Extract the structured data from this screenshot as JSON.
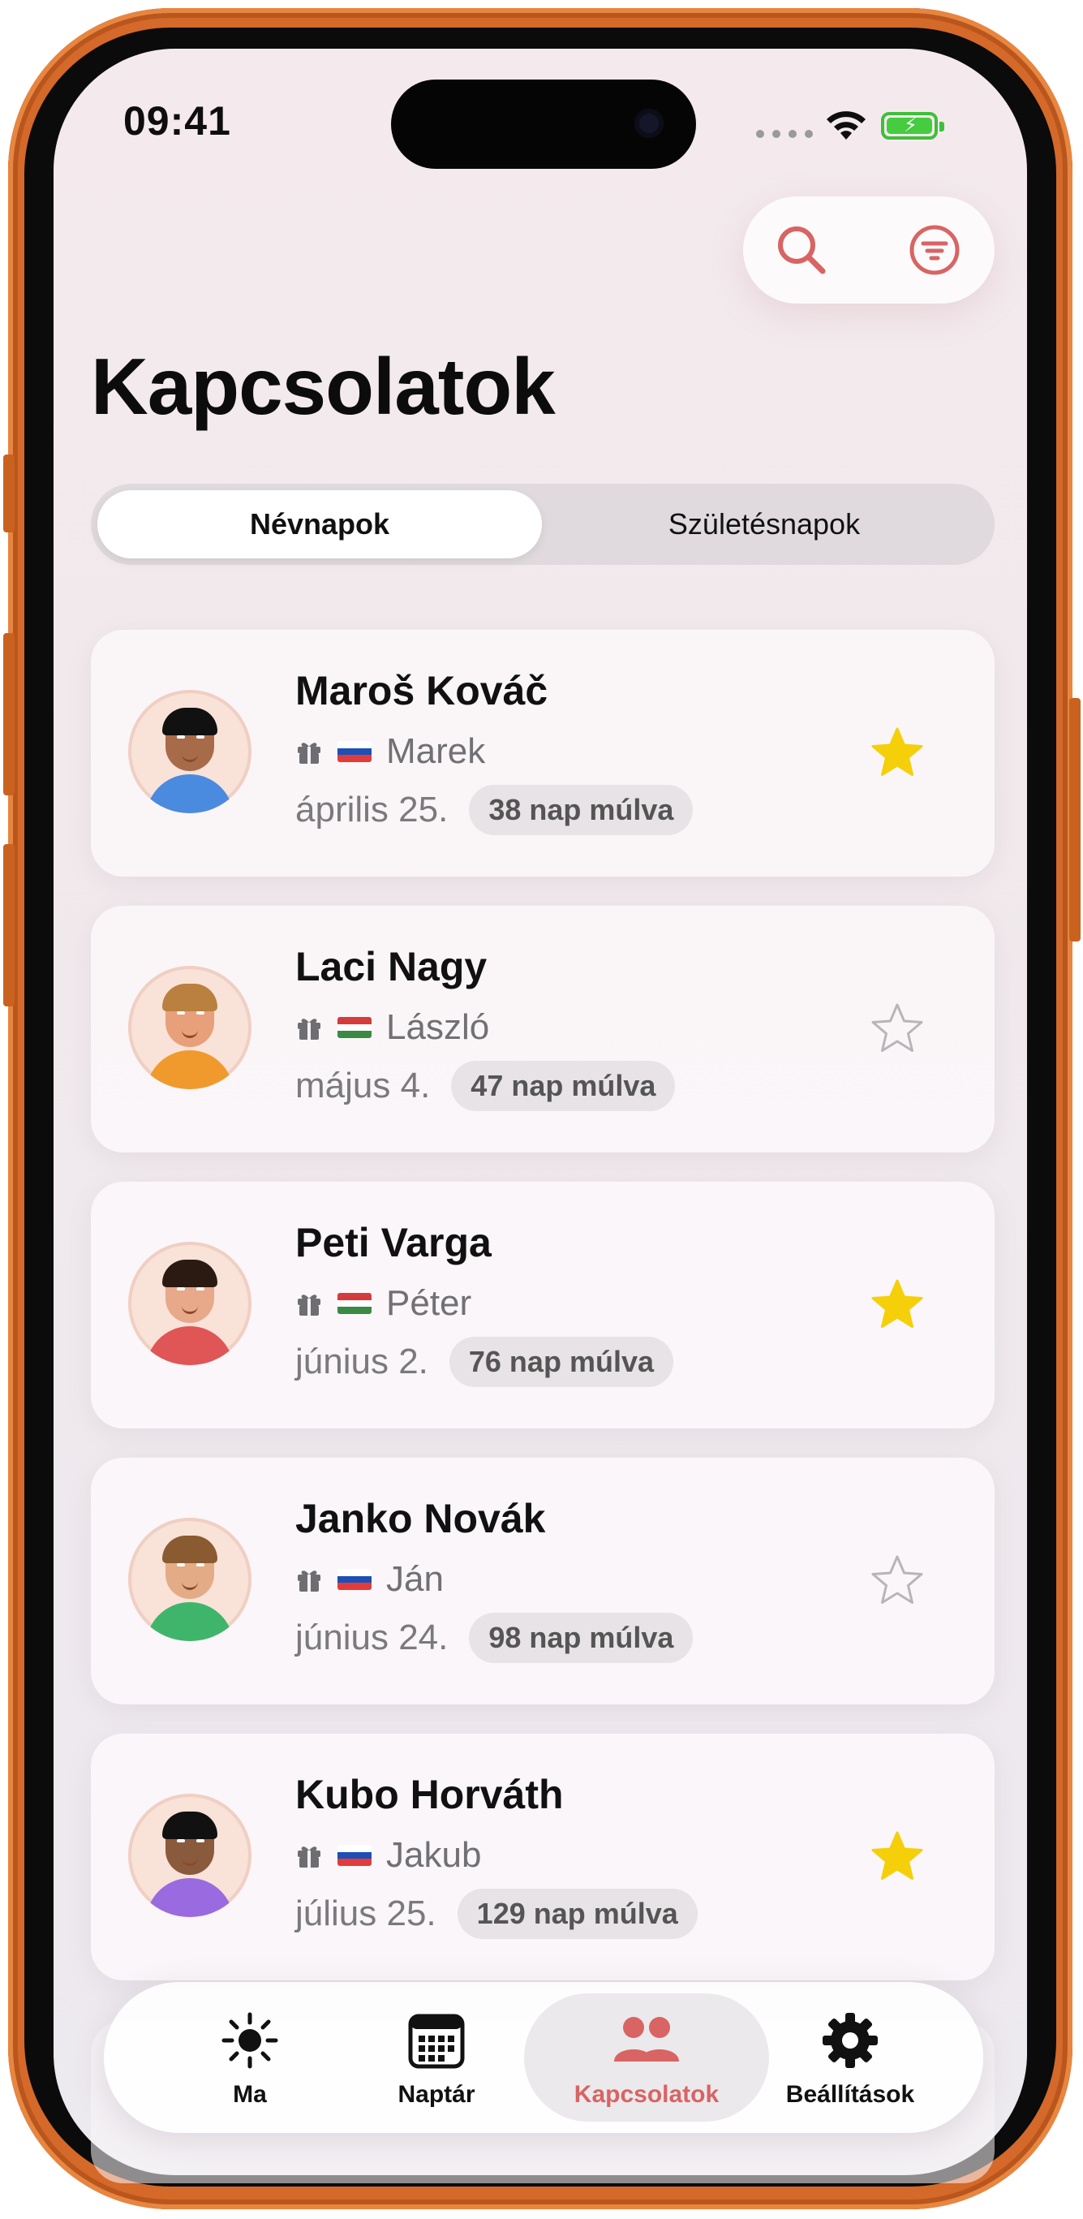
{
  "status": {
    "time": "09:41"
  },
  "page": {
    "title": "Kapcsolatok"
  },
  "segments": [
    "Névnapok",
    "Születésnapok"
  ],
  "contacts": [
    {
      "name": "Maroš Kováč",
      "country": "slovakia",
      "nameday": "Marek",
      "date": "április 25.",
      "badge": "38 nap múlva",
      "favorite": true,
      "skin": "#a86b4a",
      "hair": "#111111",
      "shirt": "#4a8be0"
    },
    {
      "name": "Laci Nagy",
      "country": "hungary",
      "nameday": "László",
      "date": "május 4.",
      "badge": "47 nap múlva",
      "favorite": false,
      "skin": "#e8a07a",
      "hair": "#b9803f",
      "shirt": "#f09a2e"
    },
    {
      "name": "Peti Varga",
      "country": "hungary",
      "nameday": "Péter",
      "date": "június 2.",
      "badge": "76 nap múlva",
      "favorite": true,
      "skin": "#e8a98a",
      "hair": "#2a1a12",
      "shirt": "#e05555"
    },
    {
      "name": "Janko Novák",
      "country": "slovakia",
      "nameday": "Ján",
      "date": "június 24.",
      "badge": "98 nap múlva",
      "favorite": false,
      "skin": "#e4ac86",
      "hair": "#8a5a30",
      "shirt": "#3fb56c"
    },
    {
      "name": "Kubo Horváth",
      "country": "slovakia",
      "nameday": "Jakub",
      "date": "július 25.",
      "badge": "129 nap múlva",
      "favorite": true,
      "skin": "#8a5a3c",
      "hair": "#111111",
      "shirt": "#9a6ae0"
    }
  ],
  "tabs": [
    {
      "label": "Ma",
      "icon": "sun-icon"
    },
    {
      "label": "Naptár",
      "icon": "calendar-icon"
    },
    {
      "label": "Kapcsolatok",
      "icon": "people-icon",
      "active": true
    },
    {
      "label": "Beállítások",
      "icon": "gear-icon"
    }
  ],
  "colors": {
    "accent": "#d86464",
    "star": "#f5cf0a",
    "frame": "#d4692a"
  }
}
